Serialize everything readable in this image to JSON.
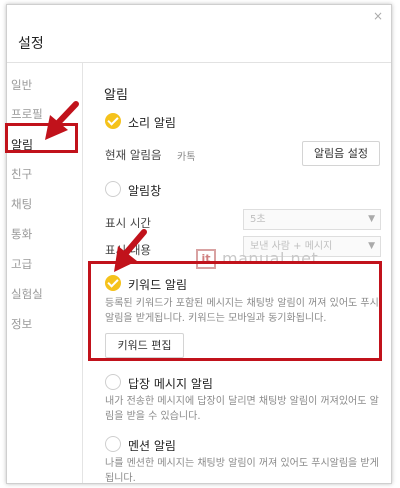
{
  "window": {
    "title": "설정",
    "close_glyph": "×"
  },
  "sidebar": {
    "items": [
      {
        "label": "일반"
      },
      {
        "label": "프로필"
      },
      {
        "label": "알림"
      },
      {
        "label": "친구"
      },
      {
        "label": "채팅"
      },
      {
        "label": "통화"
      },
      {
        "label": "고급"
      },
      {
        "label": "실험실"
      },
      {
        "label": "정보"
      }
    ],
    "selected_index": 2
  },
  "main": {
    "section_title": "알림",
    "sound_alert": {
      "label": "소리 알림",
      "checked": true
    },
    "current_sound": {
      "label": "현재 알림음",
      "value": "카톡",
      "button": "알림음 설정"
    },
    "alert_window": {
      "label": "알림창",
      "checked": false
    },
    "display_time": {
      "label": "표시 시간",
      "value": "5초"
    },
    "display_content": {
      "label": "표시 내용",
      "value": "보낸 사람 + 메시지"
    },
    "keyword_alert": {
      "label": "키워드 알림",
      "checked": true,
      "description": "등록된 키워드가 포함된 메시지는 채팅방 알림이 꺼져 있어도 푸시 알림을 받게됩니다. 키워드는 모바일과 동기화됩니다.",
      "button": "키워드 편집"
    },
    "reply_alert": {
      "label": "답장 메시지 알림",
      "checked": false,
      "description": "내가 전송한 메시지에 답장이 달리면 채팅방 알림이 꺼져있어도 알림을 받을 수 있습니다."
    },
    "mention_alert": {
      "label": "멘션 알림",
      "checked": false,
      "description": "나를 멘션한 메시지는 채팅방 알림이 꺼져 있어도 푸시알림을 받게됩니다."
    }
  },
  "watermark": {
    "badge": "it",
    "text": "manual.net"
  },
  "colors": {
    "accent": "#f5c21b",
    "highlight": "#c1121b"
  }
}
